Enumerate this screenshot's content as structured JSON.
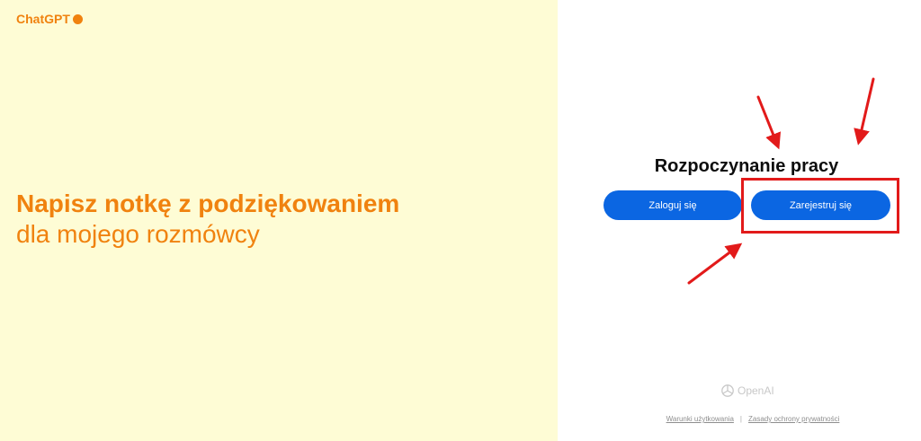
{
  "brand": {
    "name": "ChatGPT",
    "color": "#f0820f"
  },
  "hero": {
    "headline_bold": "Napisz notkę z podziękowaniem",
    "headline_light": "dla mojego rozmówcy"
  },
  "auth": {
    "title": "Rozpoczynanie pracy",
    "login_label": "Zaloguj się",
    "signup_label": "Zarejestruj się",
    "button_color": "#0b66e2"
  },
  "footer": {
    "company": "OpenAI",
    "terms_label": "Warunki użytkowania",
    "separator": "|",
    "privacy_label": "Zasady ochrony prywatności"
  },
  "annotation": {
    "highlight_color": "#e21a1a",
    "arrow_icon": "red-arrow-icon"
  },
  "colors": {
    "left_panel_bg": "#fefcd5",
    "right_panel_bg": "#ffffff"
  }
}
